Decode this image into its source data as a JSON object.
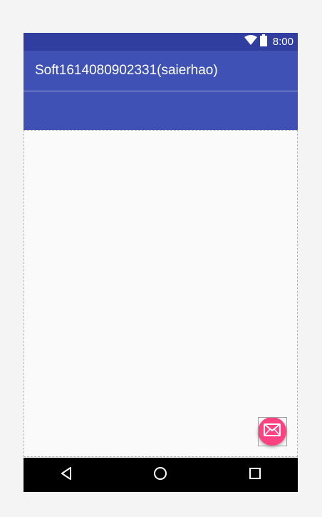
{
  "status_bar": {
    "time": "8:00",
    "icons": [
      "wifi-icon",
      "battery-icon"
    ]
  },
  "toolbar": {
    "title": "Soft1614080902331(saierhao)"
  },
  "fab": {
    "icon": "mail-icon",
    "color": "#ff4081"
  },
  "nav_bar": {
    "buttons": [
      "back-icon",
      "home-icon",
      "recents-icon"
    ]
  },
  "colors": {
    "primary": "#3f51b5",
    "primary_dark": "#303f9f",
    "accent": "#ff4081",
    "background": "#fafafa"
  }
}
